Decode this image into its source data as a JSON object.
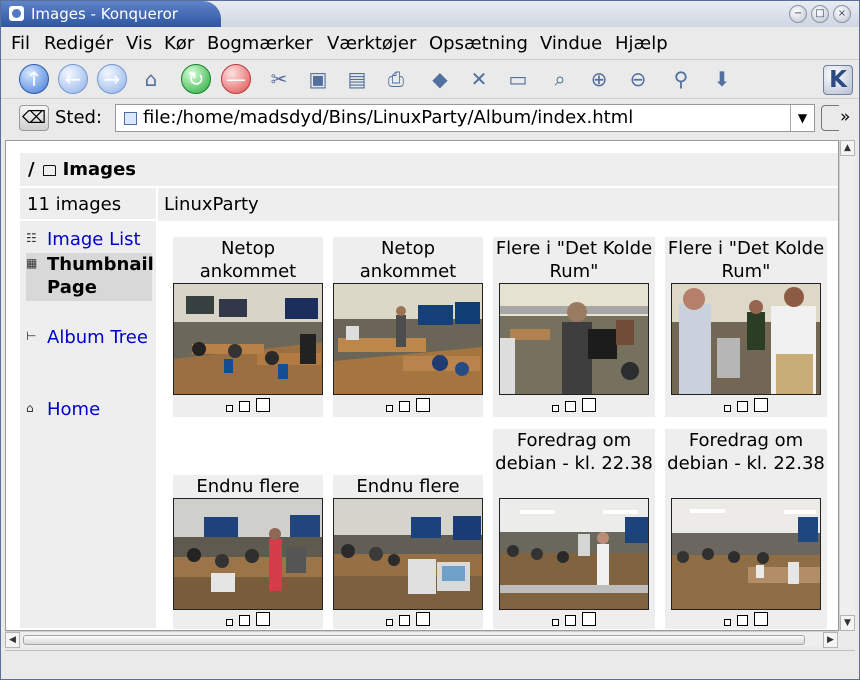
{
  "window": {
    "title": "Images - Konqueror",
    "buttons": [
      "minimize",
      "maximize",
      "close"
    ]
  },
  "menu": {
    "items": [
      "Fil",
      "Redigér",
      "Vis",
      "Kør",
      "Bogmærker",
      "Værktøjer",
      "Opsætning",
      "Vindue",
      "Hjælp"
    ]
  },
  "toolbar": {
    "icons": [
      "up-icon",
      "back-icon",
      "forward-icon",
      "home-icon",
      "reload-icon",
      "stop-icon",
      "cut-icon",
      "copy-icon",
      "paste-icon",
      "print-icon",
      "new-folder-icon",
      "delete-icon",
      "open-window-icon",
      "find-icon",
      "zoom-in-icon",
      "zoom-out-icon",
      "security-icon",
      "download-icon"
    ],
    "brand": "K"
  },
  "location": {
    "label": "Sted:",
    "url": "file:/home/madsdyd/Bins/LinuxParty/Album/index.html",
    "overflow": "»"
  },
  "page": {
    "heading": "/ Images",
    "count": "11 images",
    "album": "LinuxParty",
    "navigation": [
      {
        "label": "Image List",
        "current": false,
        "icon": "image-list-icon"
      },
      {
        "label": "Thumbnail Page",
        "current": true,
        "icon": "thumbnail-page-icon"
      },
      {
        "label": "Album Tree",
        "current": false,
        "icon": "album-tree-icon"
      },
      {
        "label": "Home",
        "current": false,
        "icon": "home-icon"
      }
    ],
    "images": [
      {
        "caption": "Netop ankommet",
        "scene": "room"
      },
      {
        "caption": "Netop ankommet",
        "scene": "room"
      },
      {
        "caption": "Flere i \"Det Kolde Rum\"",
        "scene": "people"
      },
      {
        "caption": "Flere i \"Det Kolde Rum\"",
        "scene": "people"
      },
      {
        "caption": "Endnu flere",
        "scene": "crowd"
      },
      {
        "caption": "Endnu flere",
        "scene": "crowd"
      },
      {
        "caption": "Foredrag om debian - kl. 22.38",
        "scene": "presentation"
      },
      {
        "caption": "Foredrag om debian - kl. 22.38",
        "scene": "presentation"
      }
    ]
  },
  "scrollbars": {
    "up": "▲",
    "down": "▼",
    "left": "◀",
    "right": "▶"
  }
}
